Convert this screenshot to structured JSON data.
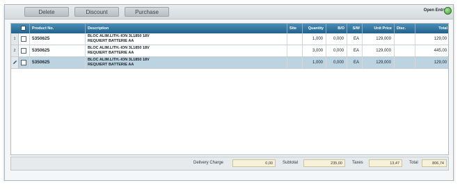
{
  "toolbar": {
    "delete_label": "Delete",
    "discount_label": "Discount",
    "purchase_label": "Purchase",
    "open_entry_label": "Open Entry"
  },
  "colors": {
    "header_blue": "#20628d",
    "selected_row": "#bcd3e2",
    "status_green": "#3f9e31",
    "footer_field": "#f6f1d8"
  },
  "columns": [
    "Product No.",
    "Description",
    "Site",
    "Quantity",
    "B/O",
    "S/W",
    "Unit Price",
    "Disc.",
    "Total"
  ],
  "rows": [
    {
      "num": "1",
      "product_no": "5350625",
      "desc1": "BLOC ALIM.LITH.-ION 3L1850 18V",
      "desc2": "REQUIERT BATTERIE AA",
      "site": "",
      "quantity": "1,000",
      "bo": "0,000",
      "sw": "EA",
      "unit_price": "129,000",
      "disc": "",
      "total": "129,00"
    },
    {
      "num": "2",
      "product_no": "5350625",
      "desc1": "BLOC ALIM.LITH.-ION 3L1850 18V",
      "desc2": "REQUIERT BATTERIE AA",
      "site": "",
      "quantity": "3,000",
      "bo": "0,000",
      "sw": "EA",
      "unit_price": "129,000",
      "disc": "",
      "total": "445,00"
    },
    {
      "num": "",
      "product_no": "5350625",
      "desc1": "BLOC ALIM.LITH.-ION 3L1850 18V",
      "desc2": "REQUIERT BATTERIE AA",
      "site": "",
      "quantity": "1,000",
      "bo": "0,000",
      "sw": "EA",
      "unit_price": "129,000",
      "disc": "",
      "total": "129,00"
    }
  ],
  "footer": {
    "delivery_charge_label": "Delivery Charge",
    "delivery_charge_value": "0,00",
    "subtotal_label": "Subtotal",
    "subtotal_value": "235,00",
    "taxes_label": "Taxes",
    "taxes_value": "13,47",
    "total_label": "Total",
    "total_value": "806,74"
  }
}
